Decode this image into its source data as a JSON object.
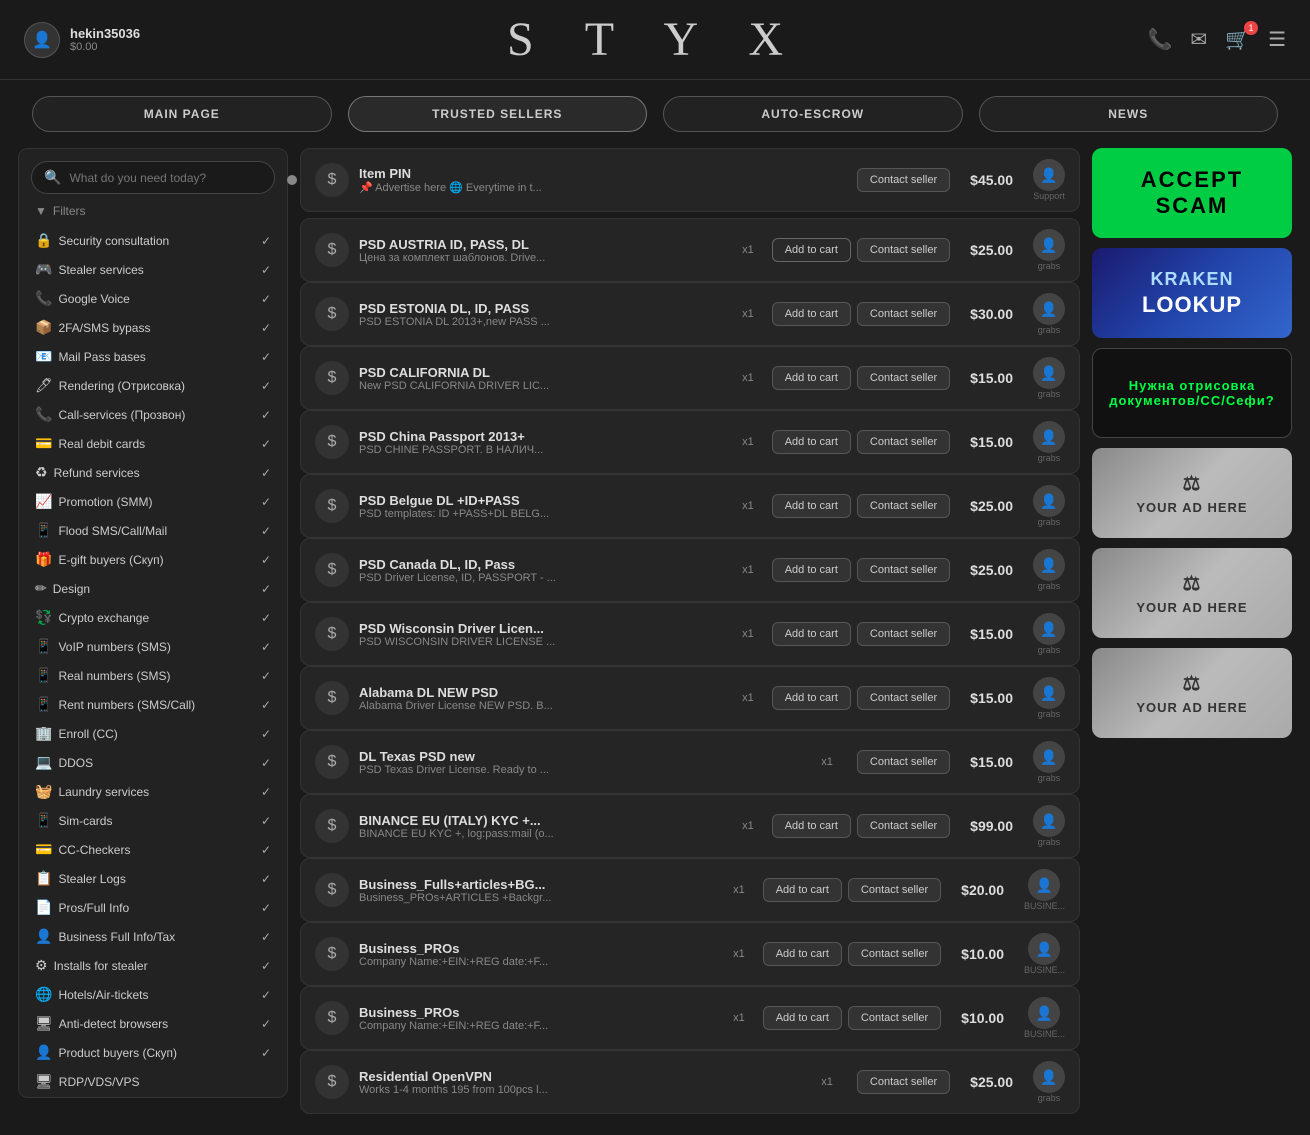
{
  "header": {
    "username": "hekin35036",
    "balance": "$0.00",
    "site_title": "S T Y X",
    "icons": {
      "phone": "📞",
      "mail": "✉",
      "cart": "🛒",
      "cart_badge": "1",
      "menu": "☰"
    }
  },
  "nav": {
    "tabs": [
      {
        "id": "main",
        "label": "MAIN PAGE"
      },
      {
        "id": "trusted",
        "label": "TRUSTED SELLERS"
      },
      {
        "id": "escrow",
        "label": "AUTO-ESCROW"
      },
      {
        "id": "news",
        "label": "NEWS"
      }
    ]
  },
  "sidebar": {
    "search_placeholder": "What do you need today?",
    "filters_label": "Filters",
    "items": [
      {
        "icon": "🔒",
        "label": "Security consultation",
        "checked": true
      },
      {
        "icon": "🎮",
        "label": "Stealer services",
        "checked": true
      },
      {
        "icon": "📞",
        "label": "Google Voice",
        "checked": true
      },
      {
        "icon": "📦",
        "label": "2FA/SMS bypass",
        "checked": true
      },
      {
        "icon": "📧",
        "label": "Mail Pass bases",
        "checked": true
      },
      {
        "icon": "🖊",
        "label": "Rendering (Отрисовка)",
        "checked": true
      },
      {
        "icon": "📞",
        "label": "Call-services (Прозвон)",
        "checked": true
      },
      {
        "icon": "💳",
        "label": "Real debit cards",
        "checked": true
      },
      {
        "icon": "♻",
        "label": "Refund services",
        "checked": true
      },
      {
        "icon": "📈",
        "label": "Promotion (SMM)",
        "checked": true
      },
      {
        "icon": "📱",
        "label": "Flood SMS/Call/Mail",
        "checked": true
      },
      {
        "icon": "🎁",
        "label": "E-gift buyers (Скуп)",
        "checked": true
      },
      {
        "icon": "✏",
        "label": "Design",
        "checked": true
      },
      {
        "icon": "💱",
        "label": "Crypto exchange",
        "checked": true
      },
      {
        "icon": "📱",
        "label": "VoIP numbers (SMS)",
        "checked": true
      },
      {
        "icon": "📱",
        "label": "Real numbers (SMS)",
        "checked": true
      },
      {
        "icon": "📱",
        "label": "Rent numbers (SMS/Call)",
        "checked": true
      },
      {
        "icon": "🏢",
        "label": "Enroll (CC)",
        "checked": true
      },
      {
        "icon": "💻",
        "label": "DDOS",
        "checked": true
      },
      {
        "icon": "🧺",
        "label": "Laundry services",
        "checked": true
      },
      {
        "icon": "📱",
        "label": "Sim-cards",
        "checked": true
      },
      {
        "icon": "💳",
        "label": "CC-Checkers",
        "checked": true
      },
      {
        "icon": "📋",
        "label": "Stealer Logs",
        "checked": true
      },
      {
        "icon": "📄",
        "label": "Pros/Full Info",
        "checked": true
      },
      {
        "icon": "👤",
        "label": "Business Full Info/Tax",
        "checked": true
      },
      {
        "icon": "⚙",
        "label": "Installs for stealer",
        "checked": true
      },
      {
        "icon": "🌐",
        "label": "Hotels/Air-tickets",
        "checked": true
      },
      {
        "icon": "🖥",
        "label": "Anti-detect browsers",
        "checked": true
      },
      {
        "icon": "👤",
        "label": "Product buyers (Скуп)",
        "checked": true
      },
      {
        "icon": "🖥",
        "label": "RDP/VDS/VPS",
        "checked": false
      }
    ]
  },
  "products": {
    "pin_item": {
      "title": "Item PIN",
      "subtitle": "📌 Advertise here 🌐 Everytime in t...",
      "price": "$45.00",
      "seller_label": "Support",
      "has_contact": true,
      "has_add": false
    },
    "items": [
      {
        "title": "PSD AUSTRIA ID, PASS, DL",
        "subtitle": "Цена за комплект шаблонов. Drive...",
        "price": "$25.00",
        "qty": "x1",
        "has_add": true,
        "add_inactive": true,
        "seller_label": "grabs"
      },
      {
        "title": "PSD ESTONIA DL, ID, PASS",
        "subtitle": "PSD ESTONIA DL 2013+,new PASS ...",
        "price": "$30.00",
        "qty": "x1",
        "has_add": true,
        "add_inactive": false,
        "seller_label": "grabs"
      },
      {
        "title": "PSD CALIFORNIA DL",
        "subtitle": "New PSD CALIFORNIA DRIVER LIC...",
        "price": "$15.00",
        "qty": "x1",
        "has_add": true,
        "add_inactive": false,
        "seller_label": "grabs"
      },
      {
        "title": "PSD China Passport 2013+",
        "subtitle": "PSD CHINE PASSPORT. В НАЛИЧ...",
        "price": "$15.00",
        "qty": "x1",
        "has_add": true,
        "add_inactive": false,
        "seller_label": "grabs"
      },
      {
        "title": "PSD Belgue DL +ID+PASS",
        "subtitle": "PSD templates: ID +PASS+DL BELG...",
        "price": "$25.00",
        "qty": "x1",
        "has_add": true,
        "add_inactive": false,
        "seller_label": "grabs"
      },
      {
        "title": "PSD Canada DL, ID, Pass",
        "subtitle": "PSD Driver License, ID, PASSPORT - ...",
        "price": "$25.00",
        "qty": "x1",
        "has_add": true,
        "add_inactive": false,
        "seller_label": "grabs"
      },
      {
        "title": "PSD Wisconsin Driver Licen...",
        "subtitle": "PSD WISCONSIN DRIVER LICENSE ...",
        "price": "$15.00",
        "qty": "x1",
        "has_add": true,
        "add_inactive": false,
        "seller_label": "grabs"
      },
      {
        "title": "Alabama DL NEW PSD",
        "subtitle": "Alabama Driver License NEW PSD. B...",
        "price": "$15.00",
        "qty": "x1",
        "has_add": true,
        "add_inactive": false,
        "seller_label": "grabs"
      },
      {
        "title": "DL Texas PSD new",
        "subtitle": "PSD Texas Driver License. Ready to ...",
        "price": "$15.00",
        "qty": "x1",
        "has_add": false,
        "has_contact_only": true,
        "seller_label": "grabs"
      },
      {
        "title": "BINANCE EU (ITALY) KYC +...",
        "subtitle": "BINANCE EU KYC +, log:pass:mail (o...",
        "price": "$99.00",
        "qty": "x1",
        "has_add": true,
        "add_inactive": false,
        "seller_label": "grabs"
      },
      {
        "title": "Business_Fulls+articles+BG...",
        "subtitle": "Business_PROs+ARTICLES +Backgr...",
        "price": "$20.00",
        "qty": "x1",
        "has_add": true,
        "add_inactive": false,
        "seller_label": "BUSINE..."
      },
      {
        "title": "Business_PROs",
        "subtitle": "Company Name:+EIN:+REG date:+F...",
        "price": "$10.00",
        "qty": "x1",
        "has_add": true,
        "add_inactive": false,
        "seller_label": "BUSINE..."
      },
      {
        "title": "Business_PROs",
        "subtitle": "Company Name:+EIN:+REG date:+F...",
        "price": "$10.00",
        "qty": "x1",
        "has_add": true,
        "add_inactive": false,
        "seller_label": "BUSINE..."
      },
      {
        "title": "Residential OpenVPN",
        "subtitle": "Works 1-4 months 195 from 100pcs l...",
        "price": "$25.00",
        "qty": "x1",
        "has_add": false,
        "has_contact_only": true,
        "seller_label": "grabs"
      }
    ]
  },
  "ads": [
    {
      "id": "accept-scam",
      "type": "green",
      "text": "ACCEPT SCAM"
    },
    {
      "id": "kraken",
      "type": "kraken",
      "top": "KRAKEN",
      "main": "LOOKUP",
      "sub": ""
    },
    {
      "id": "drawing",
      "type": "drawing",
      "text": "Нужна отрисовка документов/СС/Сефи?"
    },
    {
      "id": "your-ad-1",
      "type": "your-ad",
      "text": "YOUR AD HERE"
    },
    {
      "id": "your-ad-2",
      "type": "your-ad",
      "text": "YOUR AD HERE"
    },
    {
      "id": "your-ad-3",
      "type": "your-ad",
      "text": "YOUR AD HERE"
    }
  ],
  "buttons": {
    "add_to_cart": "Add to cart",
    "contact_seller": "Contact seller"
  }
}
